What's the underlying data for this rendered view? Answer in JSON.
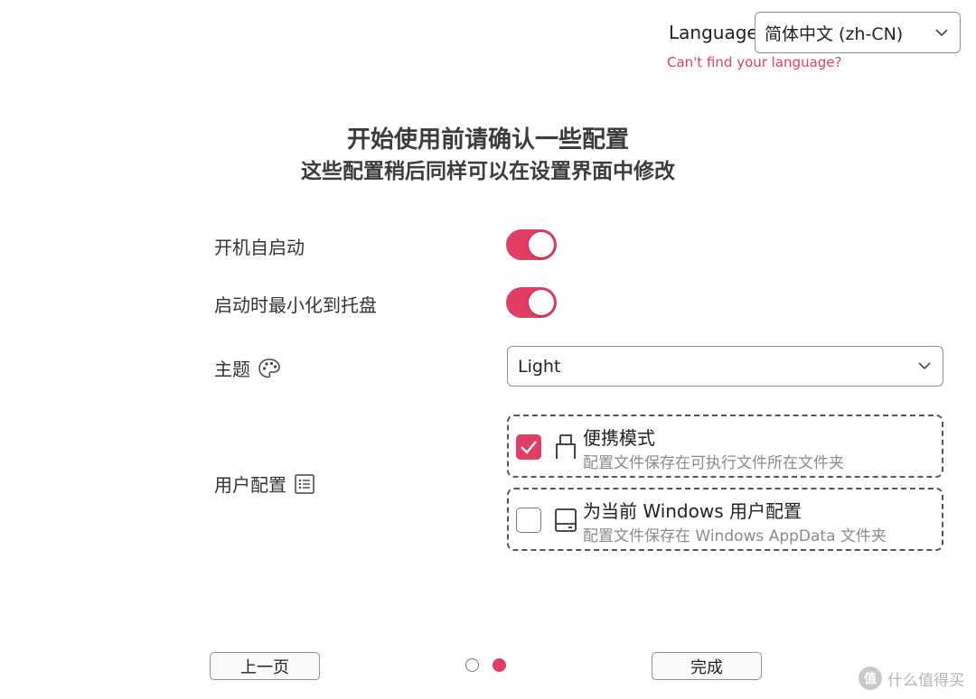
{
  "language": {
    "label": "Language:",
    "selected": "简体中文 (zh-CN)",
    "help_link": "Can't find your language?"
  },
  "heading": {
    "title": "开始使用前请确认一些配置",
    "subtitle": "这些配置稍后同样可以在设置界面中修改"
  },
  "settings": {
    "autostart": {
      "label": "开机自启动",
      "enabled": true
    },
    "minimize_to_tray": {
      "label": "启动时最小化到托盘",
      "enabled": true
    },
    "theme": {
      "label": "主题",
      "selected": "Light"
    },
    "user_config": {
      "label": "用户配置",
      "options": [
        {
          "title": "便携模式",
          "description": "配置文件保存在可执行文件所在文件夹",
          "checked": true,
          "icon": "usb-drive-icon"
        },
        {
          "title": "为当前 Windows 用户配置",
          "description": "配置文件保存在 Windows AppData 文件夹",
          "checked": false,
          "icon": "hard-drive-icon"
        }
      ]
    }
  },
  "footer": {
    "prev_label": "上一页",
    "finish_label": "完成",
    "pages": 2,
    "current_page": 2
  },
  "watermark": {
    "logo_text": "值",
    "text": "什么值得买"
  },
  "colors": {
    "accent": "#e23d62",
    "text": "#333333",
    "muted": "#8a8a8a"
  }
}
